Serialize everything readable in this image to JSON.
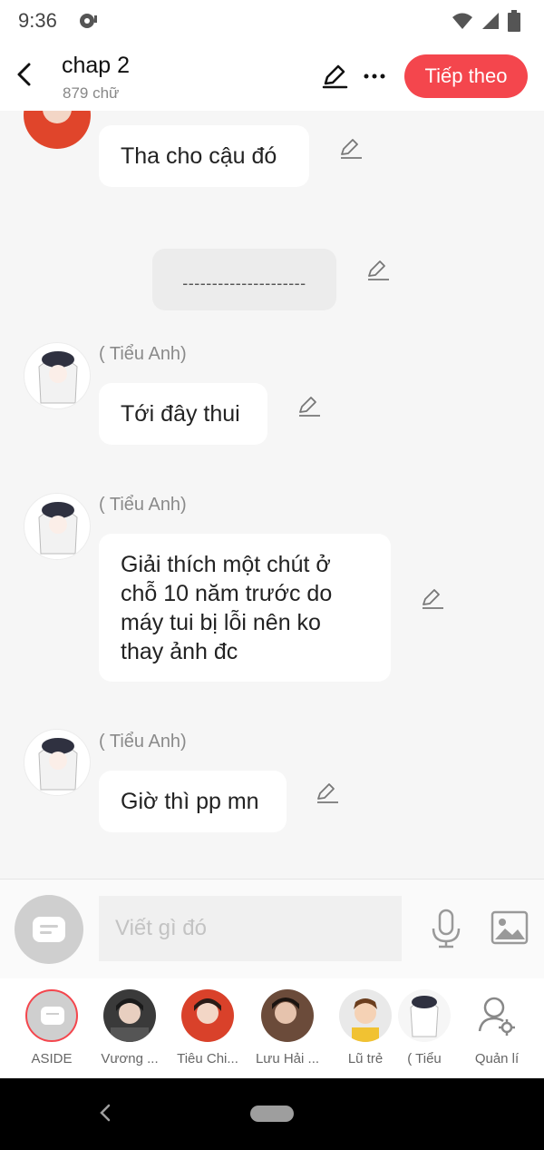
{
  "status_bar": {
    "time": "9:36"
  },
  "header": {
    "title": "chap 2",
    "subtitle": "879 chữ",
    "next_label": "Tiếp theo"
  },
  "messages": [
    {
      "text": "Tha cho cậu đó"
    },
    {
      "text": "---------------------"
    },
    {
      "sender": "( Tiểu Anh)",
      "text": "Tới đây thui"
    },
    {
      "sender": "( Tiểu Anh)",
      "text": "Giải thích một chút ở chỗ 10 năm trước do máy tui bị lỗi nên ko thay ảnh đc"
    },
    {
      "sender": "( Tiểu Anh)",
      "text": "Giờ thì pp mn"
    }
  ],
  "composer": {
    "placeholder": "Viết gì đó"
  },
  "characters": [
    {
      "name": "ASIDE"
    },
    {
      "name": "Vương ..."
    },
    {
      "name": "Tiêu Chi..."
    },
    {
      "name": "Lưu Hải ..."
    },
    {
      "name": "Lũ trẻ"
    },
    {
      "name": "( Tiểu"
    },
    {
      "name": "Quản lí"
    }
  ],
  "colors": {
    "accent": "#f4464d",
    "background": "#f6f6f6",
    "bubble": "#ffffff"
  },
  "icons": [
    "back-icon",
    "edit-icon",
    "more-icon",
    "pencil-icon",
    "mic-icon",
    "image-icon",
    "manage-icon"
  ]
}
